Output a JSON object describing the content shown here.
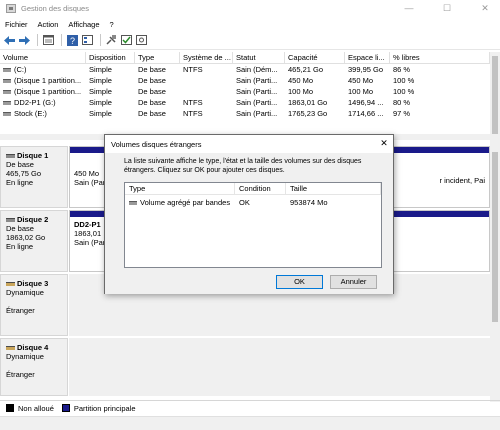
{
  "window": {
    "title": "Gestion des disques",
    "minimize": "—",
    "maximize": "☐",
    "close": "✕"
  },
  "menu": [
    "Fichier",
    "Action",
    "Affichage",
    "?"
  ],
  "toolbar": [
    "back-icon",
    "forward-icon",
    "properties-icon",
    "help-icon",
    "disk-list-icon",
    "connect-icon",
    "check-icon",
    "settings-icon"
  ],
  "volume_table": {
    "headers": [
      "Volume",
      "Disposition",
      "Type",
      "Système de ...",
      "Statut",
      "Capacité",
      "Espace li...",
      "% libres"
    ],
    "rows": [
      [
        "(C:)",
        "Simple",
        "De base",
        "NTFS",
        "Sain (Dém...",
        "465,21 Go",
        "399,95 Go",
        "86 %"
      ],
      [
        "(Disque 1 partition...",
        "Simple",
        "De base",
        "",
        "Sain (Parti...",
        "450 Mo",
        "450 Mo",
        "100 %"
      ],
      [
        "(Disque 1 partition...",
        "Simple",
        "De base",
        "",
        "Sain (Parti...",
        "100 Mo",
        "100 Mo",
        "100 %"
      ],
      [
        "DD2-P1 (G:)",
        "Simple",
        "De base",
        "NTFS",
        "Sain (Parti...",
        "1863,01 Go",
        "1496,94 ...",
        "80 %"
      ],
      [
        "Stock (E:)",
        "Simple",
        "De base",
        "NTFS",
        "Sain (Parti...",
        "1765,23 Go",
        "1714,66 ...",
        "97 %"
      ]
    ]
  },
  "disks": [
    {
      "name": "Disque 1",
      "type": "De base",
      "size": "465,75 Go",
      "status": "En ligne",
      "part1_size": "450 Mo",
      "part1_status": "Sain (Par",
      "part_right_status": "r incident, Pai"
    },
    {
      "name": "Disque 2",
      "type": "De base",
      "size": "1863,02 Go",
      "status": "En ligne",
      "part_name": "DD2-P1",
      "part_size": "1863,01",
      "part_status": "Sain (Par"
    },
    {
      "name": "Disque 3",
      "type": "Dynamique",
      "status": "Étranger"
    },
    {
      "name": "Disque 4",
      "type": "Dynamique",
      "status": "Étranger"
    }
  ],
  "legend": {
    "unallocated": "Non alloué",
    "primary": "Partition principale",
    "primary_color": "#1a1a8a"
  },
  "dialog": {
    "title": "Volumes disques étrangers",
    "close": "✕",
    "description": "La liste suivante affiche le type, l'état et la taille des volumes sur des disques étrangers. Cliquez sur OK pour ajouter ces disques.",
    "headers": [
      "Type",
      "Condition",
      "Taille"
    ],
    "rows": [
      [
        "Volume agrégé par bandes",
        "OK",
        "953874 Mo"
      ]
    ],
    "ok_label": "OK",
    "cancel_label": "Annuler"
  }
}
